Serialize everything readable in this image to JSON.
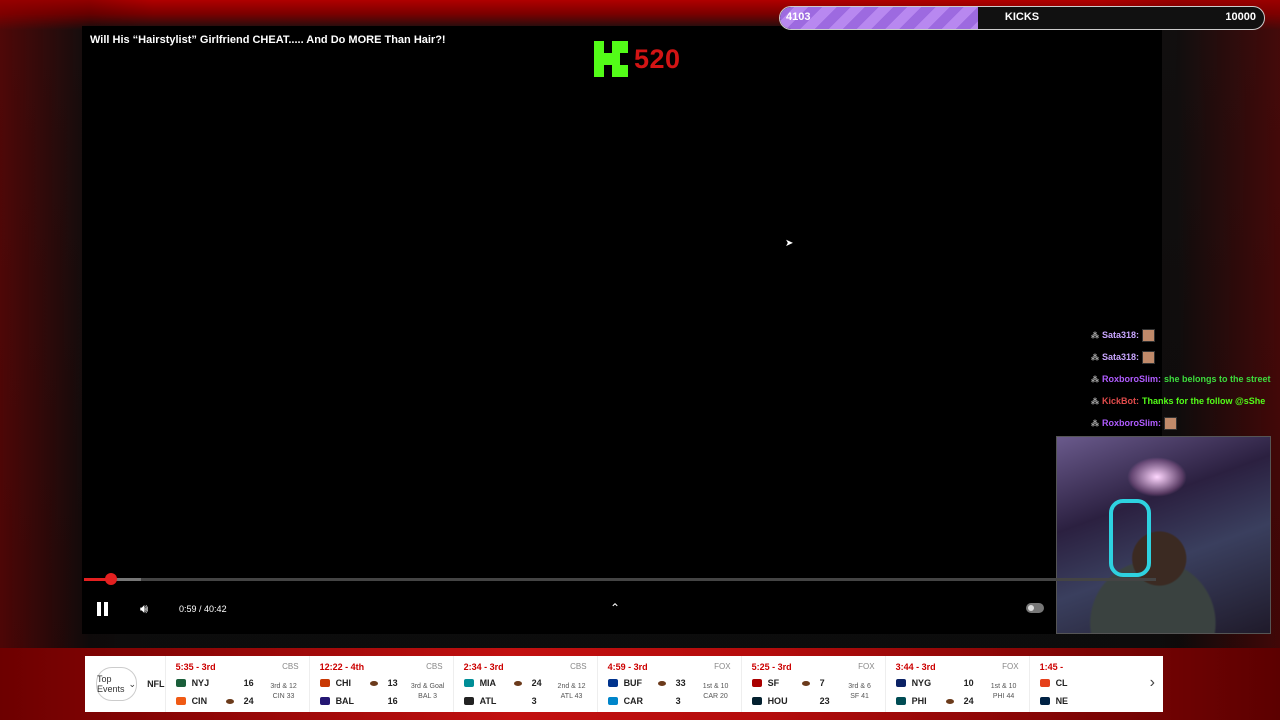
{
  "video": {
    "title": "Will His “Hairstylist” Girlfriend CHEAT..... And Do MORE Than Hair?!",
    "kick_count": "520",
    "current_time": "0:59",
    "separator": " / ",
    "duration": "40:42",
    "progress_fraction": 0.025,
    "buffer_fraction": 0.053
  },
  "goal": {
    "current": "4103",
    "label": "KICKS",
    "target": "10000",
    "fill_fraction": 0.41
  },
  "chat": [
    {
      "user": "Sata318:",
      "message": "",
      "emote": true,
      "user_color": "#c9a6ff",
      "msg_color": "#ffffff"
    },
    {
      "user": "Sata318:",
      "message": "",
      "emote": true,
      "user_color": "#c9a6ff",
      "msg_color": "#ffffff"
    },
    {
      "user": "RoxboroSlim:",
      "message": "she belongs to the street",
      "emote": false,
      "user_color": "#b05cff",
      "msg_color": "#3ddc3d"
    },
    {
      "user": "KickBot:",
      "message": "Thanks for the follow @sShe",
      "emote": false,
      "user_color": "#e14b4b",
      "msg_color": "#53fc18"
    },
    {
      "user": "RoxboroSlim:",
      "message": "",
      "emote": true,
      "user_color": "#b05cff",
      "msg_color": "#ffffff"
    }
  ],
  "ticker": {
    "top_events_label": "Top Events",
    "league": "NFL",
    "games": [
      {
        "status": "5:35 - 3rd",
        "network": "CBS",
        "t1": {
          "abbr": "NYJ",
          "score": "16",
          "color": "#1a5e3a"
        },
        "t2": {
          "abbr": "CIN",
          "score": "24",
          "color": "#f05a14"
        },
        "possession": 2,
        "situation": [
          "3rd & 12",
          "CIN 33"
        ]
      },
      {
        "status": "12:22 - 4th",
        "network": "CBS",
        "t1": {
          "abbr": "CHI",
          "score": "13",
          "color": "#c83803"
        },
        "t2": {
          "abbr": "BAL",
          "score": "16",
          "color": "#241773"
        },
        "possession": 1,
        "situation": [
          "3rd & Goal",
          "BAL 3"
        ]
      },
      {
        "status": "2:34 - 3rd",
        "network": "CBS",
        "t1": {
          "abbr": "MIA",
          "score": "24",
          "color": "#008e97"
        },
        "t2": {
          "abbr": "ATL",
          "score": "3",
          "color": "#222222"
        },
        "possession": 1,
        "situation": [
          "2nd & 12",
          "ATL 43"
        ]
      },
      {
        "status": "4:59 - 3rd",
        "network": "FOX",
        "t1": {
          "abbr": "BUF",
          "score": "33",
          "color": "#00338d"
        },
        "t2": {
          "abbr": "CAR",
          "score": "3",
          "color": "#0085ca"
        },
        "possession": 1,
        "situation": [
          "1st & 10",
          "CAR 20"
        ]
      },
      {
        "status": "5:25 - 3rd",
        "network": "FOX",
        "t1": {
          "abbr": "SF",
          "score": "7",
          "color": "#aa0000"
        },
        "t2": {
          "abbr": "HOU",
          "score": "23",
          "color": "#03202f"
        },
        "possession": 1,
        "situation": [
          "3rd & 6",
          "SF 41"
        ]
      },
      {
        "status": "3:44 - 3rd",
        "network": "FOX",
        "t1": {
          "abbr": "NYG",
          "score": "10",
          "color": "#0b2265"
        },
        "t2": {
          "abbr": "PHI",
          "score": "24",
          "color": "#004c54"
        },
        "possession": 2,
        "situation": [
          "1st & 10",
          "PHI 44"
        ]
      },
      {
        "status": "1:45 -",
        "network": "",
        "t1": {
          "abbr": "CL",
          "score": "",
          "color": "#e5401b"
        },
        "t2": {
          "abbr": "NE",
          "score": "",
          "color": "#002244"
        },
        "possession": 0,
        "situation": [
          "",
          ""
        ]
      }
    ]
  },
  "colors": {
    "kick_green": "#53fc18",
    "accent_red": "#e42020"
  }
}
